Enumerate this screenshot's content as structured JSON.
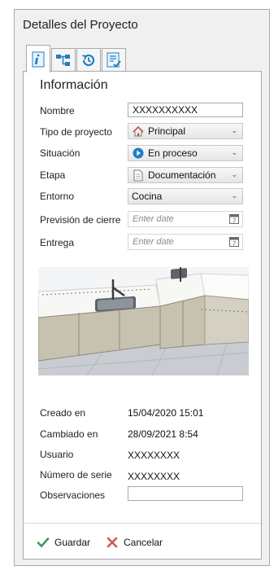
{
  "panel": {
    "title": "Detalles del Proyecto"
  },
  "tabs": [
    {
      "name": "info-icon",
      "active": true
    },
    {
      "name": "hierarchy-icon",
      "active": false
    },
    {
      "name": "history-icon",
      "active": false
    },
    {
      "name": "checklist-icon",
      "active": false
    }
  ],
  "section_title": "Información",
  "fields": {
    "nombre": {
      "label": "Nombre",
      "value": "XXXXXXXXXX"
    },
    "tipo": {
      "label": "Tipo de proyecto",
      "value": "Principal",
      "icon": "house-icon"
    },
    "situacion": {
      "label": "Situación",
      "value": "En proceso",
      "icon": "play-circle-icon"
    },
    "etapa": {
      "label": "Etapa",
      "value": "Documentación",
      "icon": "document-icon"
    },
    "entorno": {
      "label": "Entorno",
      "value": "Cocina"
    },
    "prevision": {
      "label": "Previsión de cierre",
      "placeholder": "Enter date"
    },
    "entrega": {
      "label": "Entrega",
      "placeholder": "Enter date"
    }
  },
  "meta": {
    "creado": {
      "label": "Creado en",
      "value": "15/04/2020 15:01"
    },
    "cambiado": {
      "label": "Cambiado en",
      "value": "28/09/2021 8:54"
    },
    "usuario": {
      "label": "Usuario",
      "value": "XXXXXXXX"
    },
    "serie": {
      "label": "Número de serie",
      "value": "XXXXXXXX"
    },
    "observaciones": {
      "label": "Observaciones",
      "value": ""
    }
  },
  "actions": {
    "save_label": "Guardar",
    "cancel_label": "Cancelar"
  },
  "colors": {
    "save_check": "#3a9a5b",
    "cancel_x": "#d9534f",
    "tab_icon": "#1e7fc4"
  }
}
